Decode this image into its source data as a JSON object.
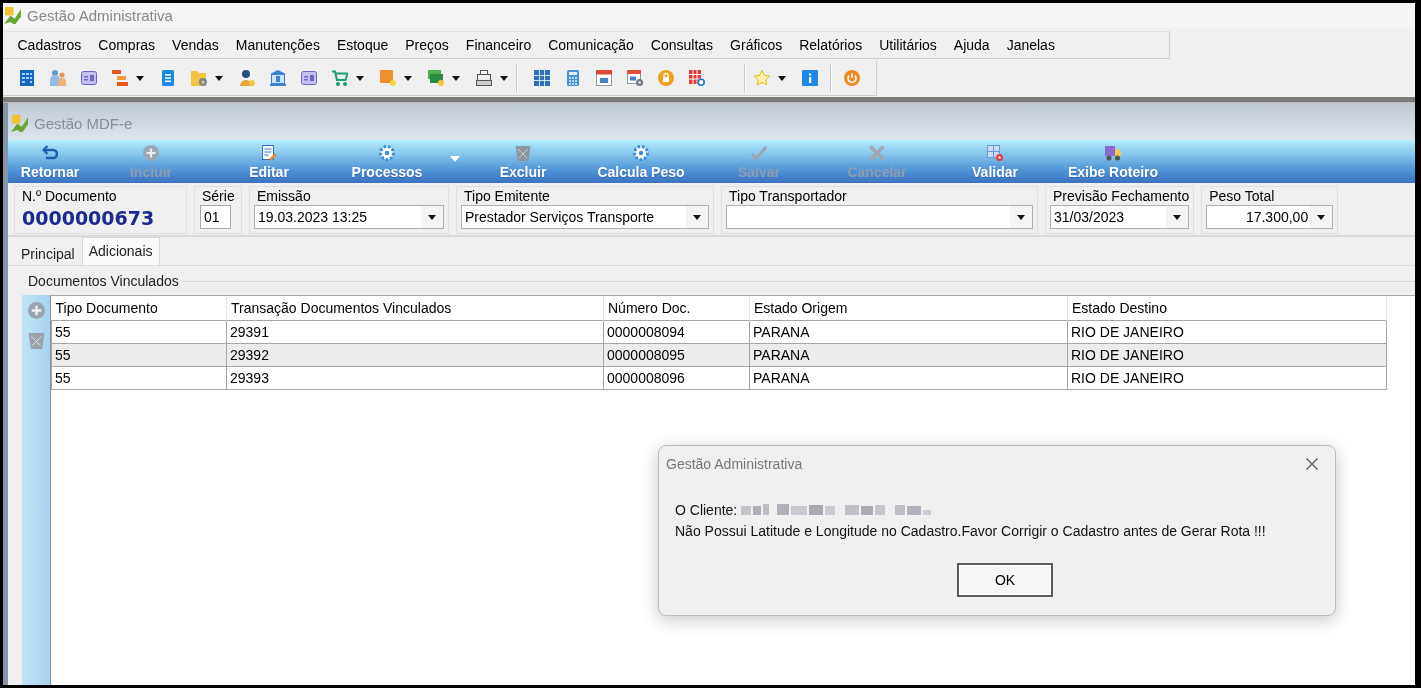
{
  "window": {
    "title": "Gestão Administrativa"
  },
  "menu_bar": [
    "Cadastros",
    "Compras",
    "Vendas",
    "Manutenções",
    "Estoque",
    "Preços",
    "Financeiro",
    "Comunicação",
    "Consultas",
    "Gráficos",
    "Relatórios",
    "Utilitários",
    "Ajuda",
    "Janelas"
  ],
  "toolbar": {
    "groups": [
      {
        "buttons": [
          {
            "dropdown": false
          },
          {
            "dropdown": false
          },
          {
            "dropdown": false
          },
          {
            "dropdown": true
          },
          {
            "dropdown": false
          },
          {
            "dropdown": true
          },
          {
            "dropdown": false
          },
          {
            "dropdown": false
          },
          {
            "dropdown": false
          },
          {
            "dropdown": true
          },
          {
            "dropdown": true
          },
          {
            "dropdown": true
          },
          {
            "dropdown": true
          }
        ]
      },
      {
        "buttons": [
          {
            "dropdown": false
          },
          {
            "dropdown": false
          },
          {
            "dropdown": false
          },
          {
            "dropdown": false
          },
          {
            "dropdown": false
          },
          {
            "dropdown": false
          }
        ]
      },
      {
        "buttons": [
          {
            "dropdown": true
          },
          {
            "dropdown": false
          }
        ]
      },
      {
        "buttons": [
          {
            "dropdown": false
          }
        ]
      }
    ]
  },
  "child_window": {
    "title": "Gestão MDF-e"
  },
  "action_bar": [
    {
      "label": "Retornar",
      "disabled": false,
      "dropdown": false
    },
    {
      "label": "Incluir",
      "disabled": true,
      "dropdown": false
    },
    {
      "label": "Editar",
      "disabled": false,
      "dropdown": false
    },
    {
      "label": "Processos",
      "disabled": false,
      "dropdown": true
    },
    {
      "label": "Excluir",
      "disabled": false,
      "dropdown": false
    },
    {
      "label": "Calcula Peso",
      "disabled": false,
      "dropdown": false
    },
    {
      "label": "Salvar",
      "disabled": true,
      "dropdown": false
    },
    {
      "label": "Cancelar",
      "disabled": true,
      "dropdown": false
    },
    {
      "label": "Validar",
      "disabled": false,
      "dropdown": false
    },
    {
      "label": "Exibe Roteiro",
      "disabled": false,
      "dropdown": false
    }
  ],
  "header_fields": [
    {
      "kind": "display",
      "label": "N.º Documento",
      "value": "0000000673"
    },
    {
      "kind": "text",
      "label": "Série",
      "value": "01"
    },
    {
      "kind": "combo",
      "label": "Emissão",
      "value": "19.03.2023 13:25"
    },
    {
      "kind": "combo",
      "label": "Tipo Emitente",
      "value": "Prestador Serviços Transporte"
    },
    {
      "kind": "combo",
      "label": "Tipo Transportador"
    },
    {
      "kind": "combo",
      "label": "Previsão Fechamento",
      "value": "31/03/2023"
    },
    {
      "kind": "number_combo",
      "label": "Peso Total",
      "value": "17.300,00"
    }
  ],
  "tabs": [
    {
      "label": "Principal",
      "selected": false
    },
    {
      "label": "Adicionais",
      "selected": true
    }
  ],
  "linked_documents": {
    "title": "Documentos Vinculados",
    "columns": [
      "Tipo Documento",
      "Transação Documentos Vinculados",
      "Número Doc.",
      "Estado Origem",
      "Estado Destino"
    ],
    "rows": [
      [
        "55",
        "29391",
        "0000008094",
        "PARANA",
        "RIO DE JANEIRO"
      ],
      [
        "55",
        "29392",
        "0000008095",
        "PARANA",
        "RIO DE JANEIRO"
      ],
      [
        "55",
        "29393",
        "0000008096",
        "PARANA",
        "RIO DE JANEIRO"
      ]
    ]
  },
  "dialog": {
    "title": "Gestão Administrativa",
    "client_label": "O Cliente:",
    "message": "Não Possui Latitude e Longitude no Cadastro.Favor Corrigir o Cadastro antes de Gerar Rota !!!",
    "button": "OK"
  }
}
